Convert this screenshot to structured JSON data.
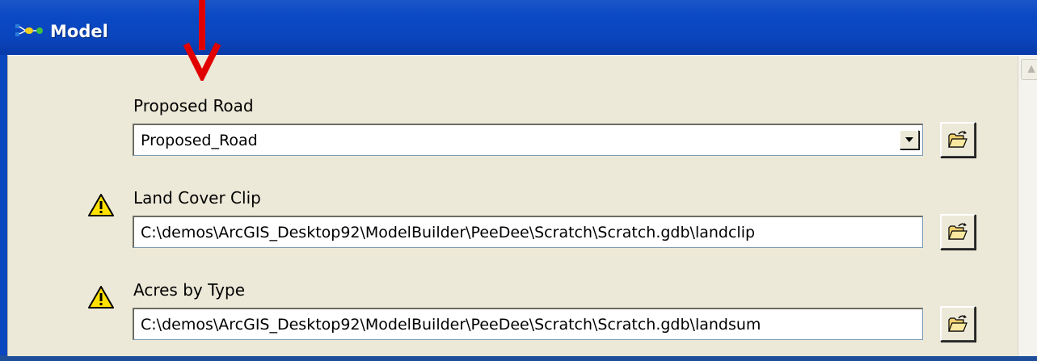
{
  "window": {
    "title": "Model",
    "icon": "model-icon"
  },
  "annotation": {
    "arrow_color": "#e00000",
    "icon": "red-down-arrow"
  },
  "parameters": [
    {
      "label": "Proposed Road",
      "value": "Proposed_Road",
      "control": "dropdown",
      "warning": false
    },
    {
      "label": "Land Cover Clip",
      "value": "C:\\demos\\ArcGIS_Desktop92\\ModelBuilder\\PeeDee\\Scratch\\Scratch.gdb\\landclip",
      "control": "text",
      "warning": true
    },
    {
      "label": "Acres by Type",
      "value": "C:\\demos\\ArcGIS_Desktop92\\ModelBuilder\\PeeDee\\Scratch\\Scratch.gdb\\landsum",
      "control": "text",
      "warning": true
    }
  ],
  "colors": {
    "titlebar": "#0a49c4",
    "dialog": "#ece9d8",
    "warning_fill": "#ffe000"
  }
}
